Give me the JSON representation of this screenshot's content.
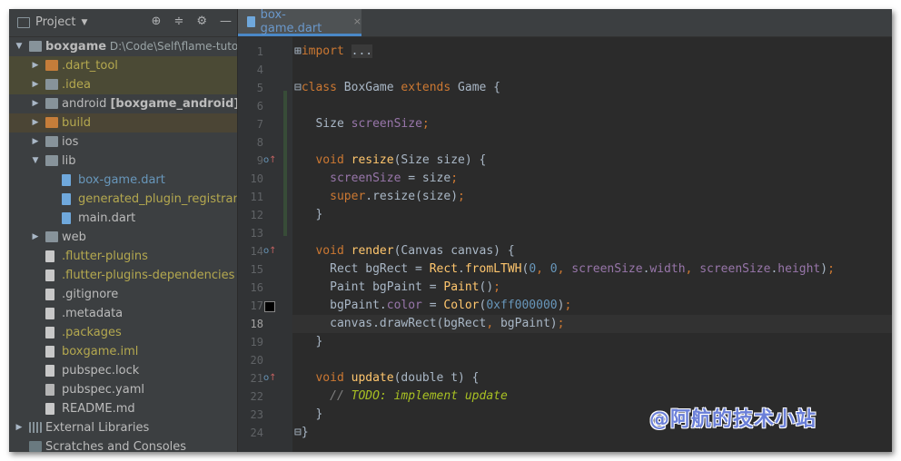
{
  "sidebar": {
    "title": "Project",
    "tools": [
      "target-icon",
      "collapse-icon",
      "gear-icon",
      "minimize-icon"
    ],
    "items": [
      {
        "label": "boxgame",
        "path": "D:\\Code\\Self\\flame-tutor",
        "indent": 0,
        "arrow": "▼",
        "icon": "folder"
      },
      {
        "label": ".dart_tool",
        "indent": 1,
        "arrow": "▶",
        "icon": "folder-orange",
        "style": "yellow",
        "bg": "yel"
      },
      {
        "label": ".idea",
        "indent": 1,
        "arrow": "▶",
        "icon": "folder",
        "style": "yellow",
        "bg": "yel"
      },
      {
        "label": "android [boxgame_android]",
        "indent": 1,
        "arrow": "▶",
        "icon": "folder"
      },
      {
        "label": "build",
        "indent": 1,
        "arrow": "▶",
        "icon": "folder-orange",
        "style": "yellow",
        "bg": "brown"
      },
      {
        "label": "ios",
        "indent": 1,
        "arrow": "▶",
        "icon": "folder"
      },
      {
        "label": "lib",
        "indent": 1,
        "arrow": "▼",
        "icon": "folder"
      },
      {
        "label": "box-game.dart",
        "indent": 2,
        "icon": "dart",
        "style": "blue"
      },
      {
        "label": "generated_plugin_registrant.dart",
        "indent": 2,
        "icon": "dart",
        "style": "yellow"
      },
      {
        "label": "main.dart",
        "indent": 2,
        "icon": "dart"
      },
      {
        "label": "web",
        "indent": 1,
        "arrow": "▶",
        "icon": "folder"
      },
      {
        "label": ".flutter-plugins",
        "indent": 1,
        "icon": "file",
        "style": "yellow"
      },
      {
        "label": ".flutter-plugins-dependencies",
        "indent": 1,
        "icon": "file",
        "style": "yellow"
      },
      {
        "label": ".gitignore",
        "indent": 1,
        "icon": "file"
      },
      {
        "label": ".metadata",
        "indent": 1,
        "icon": "file"
      },
      {
        "label": ".packages",
        "indent": 1,
        "icon": "file",
        "style": "yellow"
      },
      {
        "label": "boxgame.iml",
        "indent": 1,
        "icon": "file",
        "style": "yellow"
      },
      {
        "label": "pubspec.lock",
        "indent": 1,
        "icon": "file"
      },
      {
        "label": "pubspec.yaml",
        "indent": 1,
        "icon": "yaml"
      },
      {
        "label": "README.md",
        "indent": 1,
        "icon": "file"
      },
      {
        "label": "External Libraries",
        "indent": 0,
        "arrow": "▶",
        "icon": "libs"
      },
      {
        "label": "Scratches and Consoles",
        "indent": 0,
        "icon": "scratch"
      }
    ]
  },
  "editor": {
    "tab_label": "box-game.dart",
    "tab_close": "×",
    "current_line": 18,
    "lines": [
      {
        "n": "1",
        "html": "<span class='fold'>⊞</span><span class='k'>import</span> <span style='background:#3a3a3a;color:#a9b7c6'>...</span>"
      },
      {
        "n": "4",
        "html": ""
      },
      {
        "n": "5",
        "html": "<span class='fold'>⊟</span><span class='k'>class</span> BoxGame <span class='k'>extends</span> Game {"
      },
      {
        "n": "6",
        "html": ""
      },
      {
        "n": "7",
        "html": "   Size <span class='p'>screenSize</span><span class='k'>;</span>"
      },
      {
        "n": "8",
        "html": ""
      },
      {
        "n": "9",
        "html": "   <span class='k'>void</span> <span class='f'>resize</span>(Size size) {",
        "mark": "o↑"
      },
      {
        "n": "10",
        "html": "     <span class='p'>screenSize</span> = size<span class='k'>;</span>"
      },
      {
        "n": "11",
        "html": "     <span class='k'>super</span>.resize(size)<span class='k'>;</span>"
      },
      {
        "n": "12",
        "html": "   }"
      },
      {
        "n": "13",
        "html": ""
      },
      {
        "n": "14",
        "html": "   <span class='k'>void</span> <span class='f'>render</span>(Canvas canvas) {",
        "mark": "o↑"
      },
      {
        "n": "15",
        "html": "     Rect bgRect = <span class='f'>Rect</span>.<span class='f'>fromLTWH</span>(<span class='n'>0</span><span class='k'>,</span> <span class='n'>0</span><span class='k'>,</span> <span class='p'>screenSize</span>.<span class='p'>width</span><span class='k'>,</span> <span class='p'>screenSize</span>.<span class='p'>height</span>)<span class='k'>;</span>"
      },
      {
        "n": "16",
        "html": "     Paint bgPaint = <span class='f'>Paint</span>()<span class='k'>;</span>"
      },
      {
        "n": "17",
        "html": "     bgPaint.<span class='p'>color</span> = <span class='f'>Color</span>(<span class='n'>0xff000000</span>)<span class='k'>;</span>",
        "swatch": true
      },
      {
        "n": "18",
        "html": "     canvas.drawRect(bgRect<span class='k'>,</span> bgPaint)<span class='k'>;</span>"
      },
      {
        "n": "19",
        "html": "   }"
      },
      {
        "n": "20",
        "html": ""
      },
      {
        "n": "21",
        "html": "   <span class='k'>void</span> <span class='f'>update</span>(double t) {",
        "mark": "o↑"
      },
      {
        "n": "22",
        "html": "     <span class='c'>// </span><span class='todo'>TODO: implement update</span>"
      },
      {
        "n": "23",
        "html": "   }"
      },
      {
        "n": "24",
        "html": "<span class='fold'>⊟</span>}"
      }
    ]
  },
  "watermark": "@阿航的技术小站",
  "colors": {
    "bg": "#2b2b2b",
    "sidebar": "#3c3f41",
    "keyword": "#cc7832",
    "function": "#ffc66d",
    "property": "#9876aa",
    "number": "#6897bb"
  }
}
